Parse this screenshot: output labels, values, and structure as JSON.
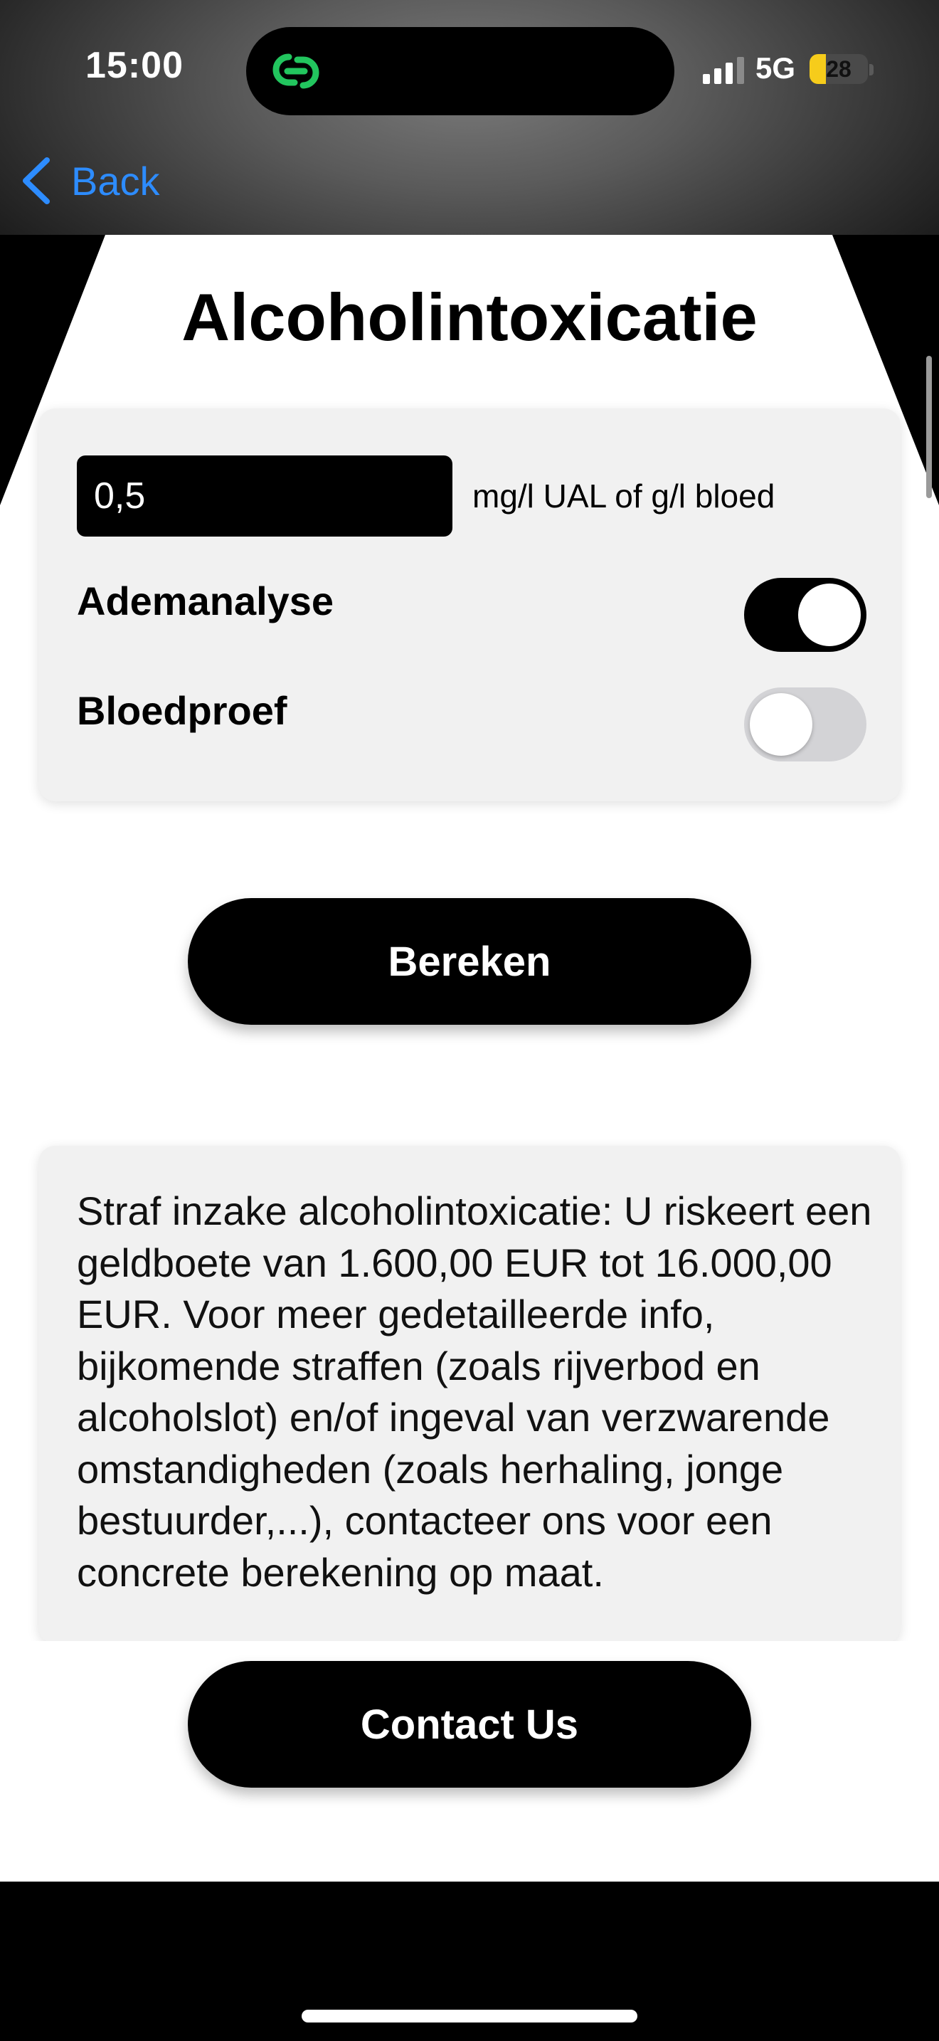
{
  "status_bar": {
    "time": "15:00",
    "network": "5G",
    "battery_level": "28",
    "battery_fraction": 0.28,
    "battery_color": "#f6cc1b",
    "island_icon": "link-chain-icon",
    "island_icon_color": "#22c55e"
  },
  "nav": {
    "back_label": "Back",
    "accent_color": "#2d8cff"
  },
  "page": {
    "title": "Alcoholintoxicatie"
  },
  "form": {
    "value": "0,5",
    "unit_label": "mg/l UAL of g/l bloed",
    "toggles": [
      {
        "label": "Ademanalyse",
        "on": true
      },
      {
        "label": "Bloedproef",
        "on": false
      }
    ],
    "calculate_label": "Bereken"
  },
  "result": {
    "text": "Straf inzake alcoholintoxicatie: U riskeert een geldboete van 1.600,00 EUR tot 16.000,00 EUR. Voor meer gedetailleerde info, bijkomende straffen (zoals rijverbod en alcoholslot) en/of ingeval van verzwarende omstandigheden (zoals herhaling, jonge bestuurder,...), contacteer ons voor een concrete berekening op maat."
  },
  "footer": {
    "contact_label": "Contact Us"
  }
}
